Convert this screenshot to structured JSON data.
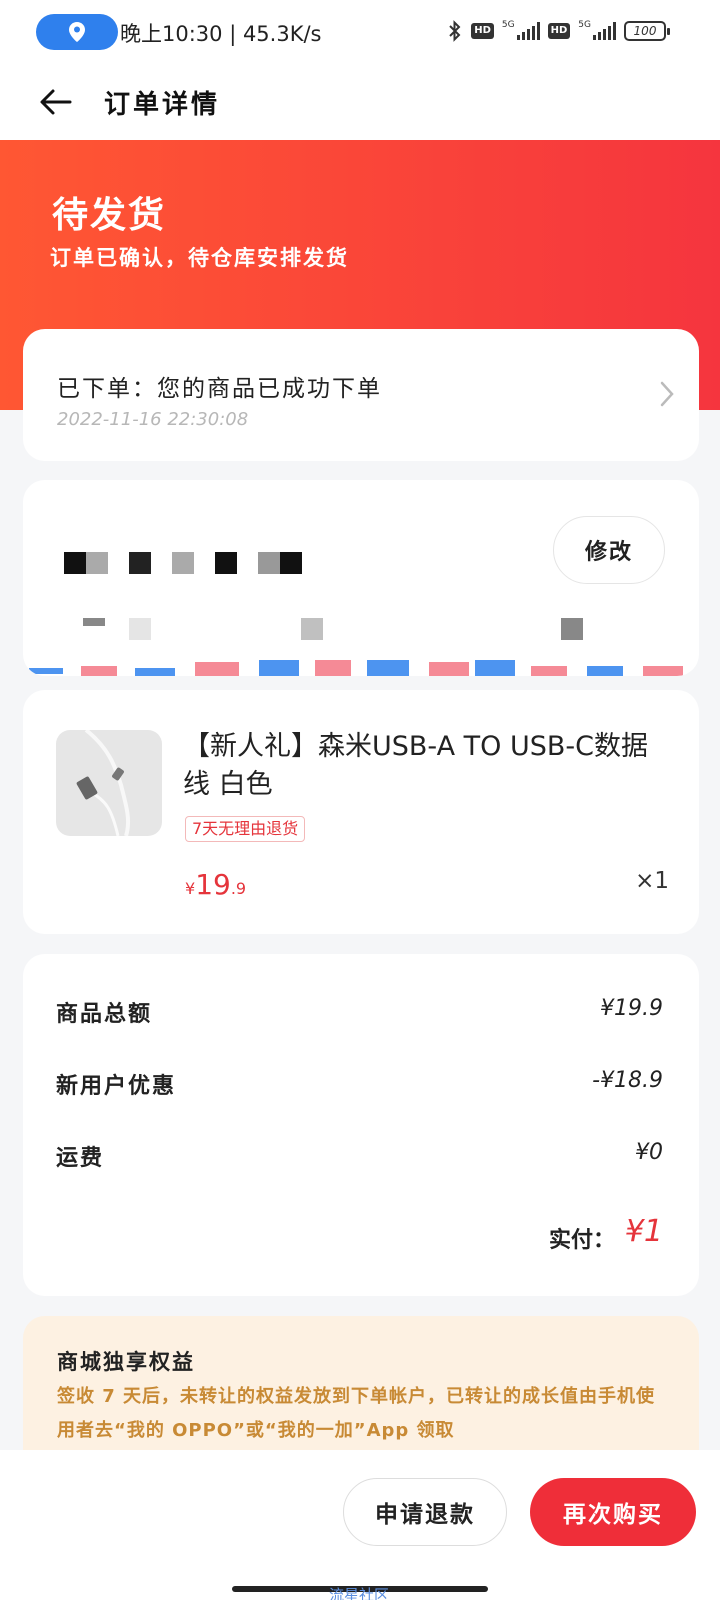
{
  "status_bar": {
    "text": "晚上10:30 | 45.3K/s",
    "battery": "100",
    "network": "5G"
  },
  "header": {
    "title": "订单详情"
  },
  "hero": {
    "title": "待发货",
    "subtitle": "订单已确认，待仓库安排发货"
  },
  "order_status": {
    "line": "已下单：您的商品已成功下单",
    "time": "2022-11-16 22:30:08"
  },
  "address": {
    "edit_label": "修改"
  },
  "product": {
    "title": "【新人礼】森米USB-A TO USB-C数据线 白色",
    "badge": "7天无理由退货",
    "price_currency": "¥",
    "price_integer": "19",
    "price_decimal": ".9",
    "quantity": "×1"
  },
  "summary": {
    "rows": [
      {
        "label": "商品总额",
        "value": "¥19.9"
      },
      {
        "label": "新用户优惠",
        "value": "-¥18.9"
      },
      {
        "label": "运费",
        "value": "¥0"
      }
    ],
    "pay_label": "实付：",
    "pay_value": "¥1"
  },
  "benefit": {
    "title": "商城独享权益",
    "text": "签收 7 天后，未转让的权益发放到下单帐户，已转让的成长值由手机使用者去“我的 OPPO”或“我的一加”App 领取"
  },
  "actions": {
    "refund_label": "申请退款",
    "rebuy_label": "再次购买"
  },
  "watermark": "流星社区",
  "colors": {
    "accent_red": "#ef2e39",
    "hero_gradient_start": "#ff5733",
    "hero_gradient_end": "#f5353e",
    "benefit_bg": "#fdf1e2",
    "benefit_text": "#c88a35",
    "location_pill": "#2f80ed"
  }
}
